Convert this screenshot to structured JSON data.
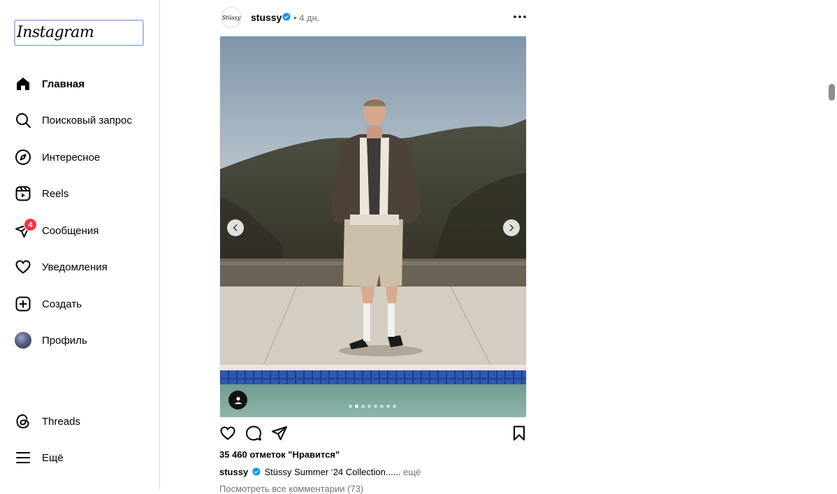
{
  "sidebar": {
    "logo": "Instagram",
    "items": [
      {
        "label": "Главная",
        "icon": "home-icon",
        "active": true
      },
      {
        "label": "Поисковый запрос",
        "icon": "search-icon"
      },
      {
        "label": "Интересное",
        "icon": "compass-icon"
      },
      {
        "label": "Reels",
        "icon": "reels-icon"
      },
      {
        "label": "Сообщения",
        "icon": "direct-icon",
        "badge": "4"
      },
      {
        "label": "Уведомления",
        "icon": "heart-icon"
      },
      {
        "label": "Создать",
        "icon": "plus-square-icon"
      },
      {
        "label": "Профиль",
        "icon": "avatar"
      }
    ],
    "bottom": [
      {
        "label": "Threads",
        "icon": "threads-icon"
      },
      {
        "label": "Ещё",
        "icon": "menu-icon"
      }
    ]
  },
  "post": {
    "avatar_text": "Stüssy",
    "username": "stussy",
    "separator": "•",
    "time": "4 дн.",
    "carousel": {
      "count": 8,
      "active_index": 1
    },
    "likes": "35 460 отметок \"Нравится\"",
    "caption_user": "stussy",
    "caption_text": "Stüssy Summer ‘24 Collection......",
    "caption_more": "ещё",
    "comments_link": "Посмотреть все комментарии (73)"
  },
  "colors": {
    "badge": "#ff3040",
    "verified": "#0095f6",
    "muted_text": "#737373",
    "border": "#dbdbdb"
  }
}
